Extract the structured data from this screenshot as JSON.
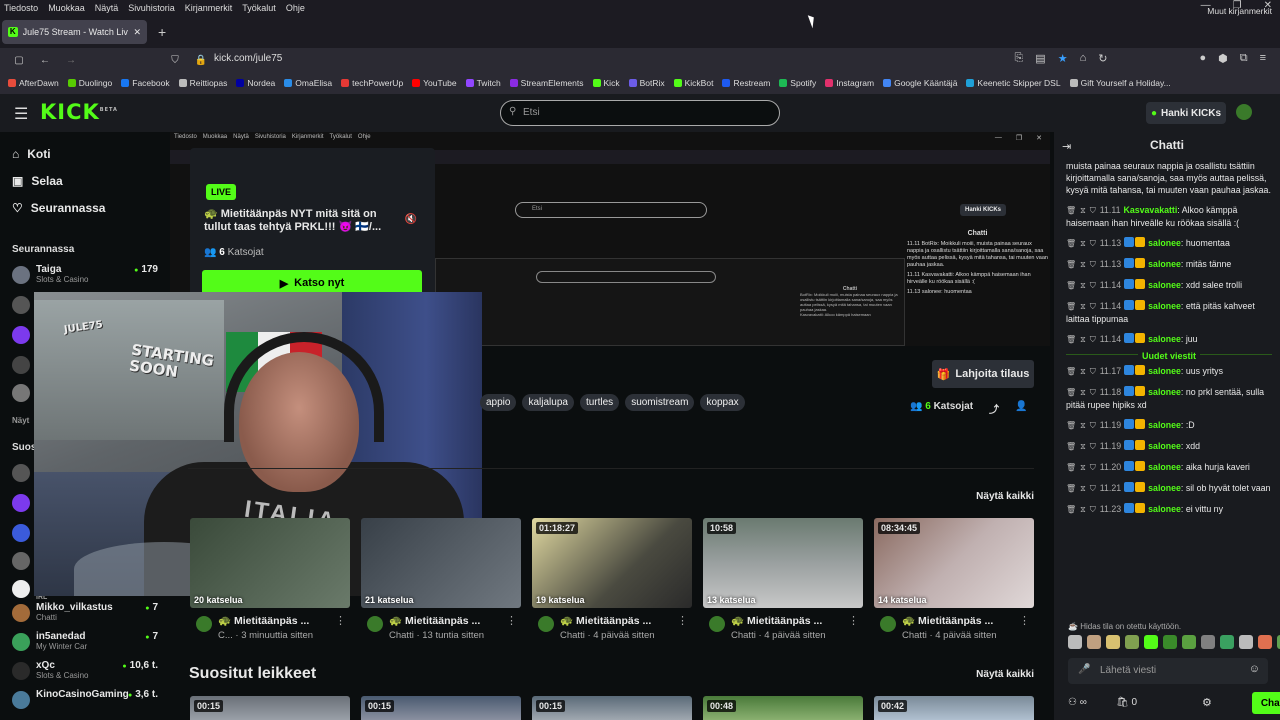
{
  "menubar": [
    "Tiedosto",
    "Muokkaa",
    "Näytä",
    "Sivuhistoria",
    "Kirjanmerkit",
    "Työkalut",
    "Ohje"
  ],
  "tab": {
    "title": "Jule75 Stream - Watch Live on K"
  },
  "url": "kick.com/jule75",
  "bookmarks": [
    {
      "label": "AfterDawn",
      "color": "#e74c3c"
    },
    {
      "label": "Duolingo",
      "color": "#58cc02"
    },
    {
      "label": "Facebook",
      "color": "#1877f2"
    },
    {
      "label": "Reittiopas",
      "color": "#bbbbbb"
    },
    {
      "label": "Nordea",
      "color": "#0000a0"
    },
    {
      "label": "OmaElisa",
      "color": "#2a8ce8"
    },
    {
      "label": "techPowerUp",
      "color": "#e53935"
    },
    {
      "label": "YouTube",
      "color": "#ff0000"
    },
    {
      "label": "Twitch",
      "color": "#9146ff"
    },
    {
      "label": "StreamElements",
      "color": "#8a2be2"
    },
    {
      "label": "Kick",
      "color": "#53fc18"
    },
    {
      "label": "BotRix",
      "color": "#6c5ce7"
    },
    {
      "label": "KickBot",
      "color": "#53fc18"
    },
    {
      "label": "Restream",
      "color": "#1e5af0"
    },
    {
      "label": "Spotify",
      "color": "#1db954"
    },
    {
      "label": "Instagram",
      "color": "#e1306c"
    },
    {
      "label": "Google Kääntäjä",
      "color": "#4285f4"
    },
    {
      "label": "Keenetic Skipper DSL",
      "color": "#1fa0d8"
    },
    {
      "label": "Gift Yourself a Holiday...",
      "color": "#bbbbbb"
    }
  ],
  "bookmarks_other": "Muut kirjanmerkit",
  "header": {
    "logo": "KICK",
    "logo_beta": "BETA",
    "search_placeholder": "Etsi",
    "hanki_label": "Hanki KICKs"
  },
  "sidebar": {
    "nav": [
      {
        "label": "Koti",
        "icon": "home-icon"
      },
      {
        "label": "Selaa",
        "icon": "browse-icon"
      },
      {
        "label": "Seurannassa",
        "icon": "heart-icon"
      }
    ],
    "following_header": "Seurannassa",
    "following_first": {
      "name": "Taiga",
      "category": "Slots & Casino",
      "viewers": "179"
    },
    "clipped_header_1": "Näyt",
    "clipped_header_2": "Suos",
    "clipped_irl": "IRL",
    "recommended": [
      {
        "name": "Mikko_vilkastus",
        "category": "Chatti",
        "viewers": "7"
      },
      {
        "name": "in5anedad",
        "category": "My Winter Car",
        "viewers": "7"
      },
      {
        "name": "xQc",
        "category": "Slots & Casino",
        "viewers": "10,6 t."
      },
      {
        "name": "KinoCasinoGaming",
        "category": "",
        "viewers": "3,6 t."
      }
    ]
  },
  "nested_screen": {
    "menubar": [
      "Tiedosto",
      "Muokkaa",
      "Näytä",
      "Sivuhistoria",
      "Kirjanmerkit",
      "Työkalut",
      "Ohje"
    ],
    "search_placeholder": "Etsi",
    "hanki_label": "Hanki KICKs",
    "chat_title": "Chatti",
    "chat_lines": [
      "11.11 BotRix: Moikkuli moiii, muista painaa seuraux nappia ja osallistu tsättiin kirjoittamalla sana/sanoja, saa myös auttaa pelissä, kysyä mitä tahansa, tai muuten vaan pauhaa jaskaa.",
      "11.11 Kasvavakatti: Alkoo kämppä haisemaan ihan hirveälle ku röökaa sisällä :(",
      "11.13 salonee: huomentaa"
    ],
    "deep_chat_title": "Chatti",
    "deep_chat_lines": [
      "BotRix: Moikkuli moiii, muista painaa seuraux nappia ja osallistu tsättiin kirjoittamalla sana/sanoja, saa myös auttaa pelissä, kysyä mitä tahansa, tai muuten vaan pauhaa jaskaa.",
      "Kasvavakatti: Alkoo kämppä haisemaan"
    ]
  },
  "live_card": {
    "badge": "LIVE",
    "title": "🐢 Mietitäänpäs NYT mitä sitä on tullut taas tehtyä PRKL!!! 😈 🇫🇮/...",
    "viewers_count": "6",
    "viewers_label": "Katsojat",
    "watch_label": "Katsonyt",
    "watch_label_text": "Katso nyt"
  },
  "webcam": {
    "poster_text": "STARTING SOON",
    "poster_subtext": "JULE75",
    "shirt_text": "ITALIA"
  },
  "tags": [
    "appio",
    "kaljalupa",
    "turtles",
    "suomistream",
    "koppax"
  ],
  "stream_actions": {
    "gift_label": "Lahjoita tilaus",
    "viewers_count": "6",
    "viewers_label": "Katsojat"
  },
  "videos_section": {
    "see_all": "Näytä kaikki",
    "videos": [
      {
        "duration": "",
        "views": "20 katselua",
        "title": "🐢 Mietitäänpäs ...",
        "sub": "C... · 3 minuuttia sitten",
        "bg": "linear-gradient(135deg,#3a4a3a,#6a7a6a)"
      },
      {
        "duration": "",
        "views": "21 katselua",
        "title": "🐢 Mietitäänpäs ...",
        "sub": "Chatti · 13 tuntia sitten",
        "bg": "linear-gradient(135deg,#384048,#707880)"
      },
      {
        "duration": "01:18:27",
        "views": "19 katselua",
        "title": "🐢 Mietitäänpäs ...",
        "sub": "Chatti · 4 päivää sitten",
        "bg": "linear-gradient(135deg,#e0d8a0,#4a4a40 60%,#2a2a2a)"
      },
      {
        "duration": "10:58",
        "views": "13 katselua",
        "title": "🐢 Mietitäänpäs ...",
        "sub": "Chatti · 4 päivää sitten",
        "bg": "linear-gradient(180deg,#6a7a70,#9aa0a0 50%,#c8c8c8)"
      },
      {
        "duration": "08:34:45",
        "views": "14 katselua",
        "title": "🐢 Mietitäänpäs ...",
        "sub": "Chatti · 4 päivää sitten",
        "bg": "linear-gradient(135deg,#8a6a60,#c0b0b0 50%,#e0d8d8)"
      }
    ]
  },
  "clips_section": {
    "title": "Suositut leikkeet",
    "see_all": "Näytä kaikki",
    "clips": [
      {
        "duration": "00:15",
        "bg": "linear-gradient(180deg,#6a7078,#9aa0a8)"
      },
      {
        "duration": "00:15",
        "bg": "linear-gradient(180deg,#4a5a70,#8a90a0)"
      },
      {
        "duration": "00:15",
        "bg": "linear-gradient(180deg,#5a6a78,#a0a8b0)"
      },
      {
        "duration": "00:48",
        "bg": "linear-gradient(180deg,#4a7a3a,#8ab070)"
      },
      {
        "duration": "00:42",
        "bg": "linear-gradient(180deg,#7a8a98,#b0c0d0)"
      }
    ]
  },
  "chat": {
    "title": "Chatti",
    "top_text": "muista painaa seuraux nappia ja osallistu tsättiin kirjoittamalla sana/sanoja, saa myös auttaa pelissä, kysyä mitä tahansa, tai muuten vaan pauhaa jaskaa.",
    "messages_before": [
      {
        "time": "11.11",
        "user": "Kasvavakatti",
        "text": "Alkoo kämppä haisemaan ihan hirveälle ku röökaa sisällä :("
      },
      {
        "time": "11.13",
        "user": "salonee",
        "text": "huomentaa"
      },
      {
        "time": "11.13",
        "user": "salonee",
        "text": "mitäs tänne"
      },
      {
        "time": "11.14",
        "user": "salonee",
        "text": "xdd salee trolli"
      },
      {
        "time": "11.14",
        "user": "salonee",
        "text": "että pitäs kahveet laittaa tippumaa"
      },
      {
        "time": "11.14",
        "user": "salonee",
        "text": "juu"
      }
    ],
    "new_divider": "Uudet viestit",
    "messages_after": [
      {
        "time": "11.17",
        "user": "salonee",
        "text": "uus yritys"
      },
      {
        "time": "11.18",
        "user": "salonee",
        "text": "no prkl sentää, sulla pitää rupee hipiks xd"
      },
      {
        "time": "11.19",
        "user": "salonee",
        "text": ":D"
      },
      {
        "time": "11.19",
        "user": "salonee",
        "text": "xdd"
      },
      {
        "time": "11.20",
        "user": "salonee",
        "text": "aika hurja kaveri"
      },
      {
        "time": "11.21",
        "user": "salonee",
        "text": "sil ob hyvät tolet vaan"
      },
      {
        "time": "11.23",
        "user": "salonee",
        "text": "ei vittu ny"
      }
    ],
    "slow_mode": "Hidas tila on otettu käyttöön.",
    "emote_colors": [
      "#bbbbbb",
      "#c0a080",
      "#d8c070",
      "#80a050",
      "#53fc18",
      "#3a8a2a",
      "#5aa040",
      "#808080",
      "#3aa060",
      "#bbbbbb",
      "#e07050",
      "#60a050"
    ],
    "input_placeholder": "Lähetä viesti",
    "points": "0",
    "send_label": "Chatti"
  }
}
